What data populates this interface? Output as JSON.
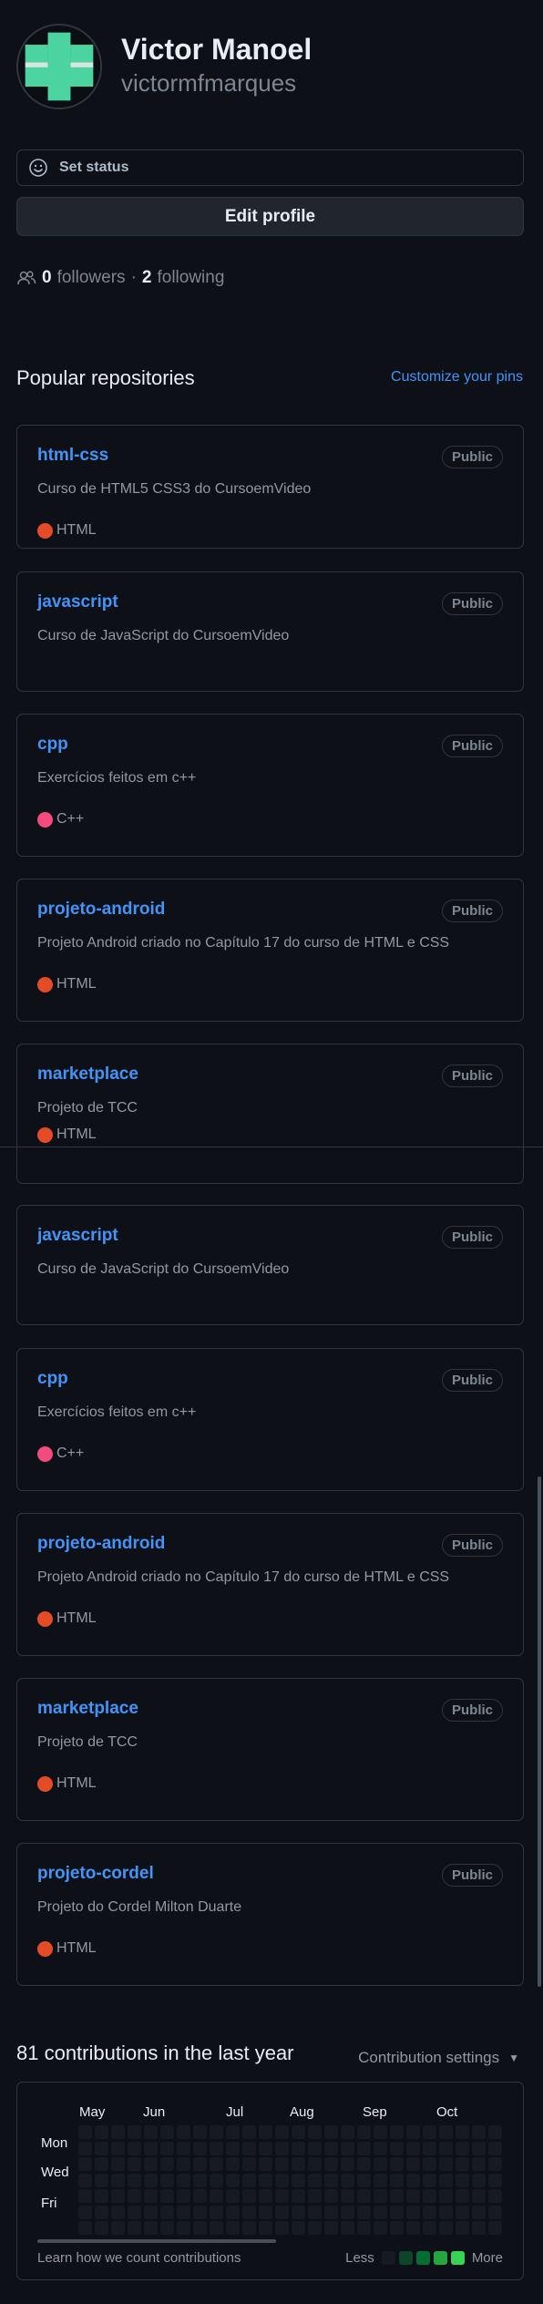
{
  "profile": {
    "name": "Victor Manoel",
    "login": "victormfmarques"
  },
  "status_button": {
    "label": "Set status"
  },
  "edit_button": {
    "label": "Edit profile"
  },
  "social": {
    "followers_count": "0",
    "followers_label": "followers",
    "separator": "·",
    "following_count": "2",
    "following_label": "following"
  },
  "popular": {
    "title": "Popular repositories",
    "customize_label": "Customize your pins"
  },
  "repos": [
    {
      "name": "html-css",
      "visibility": "Public",
      "description": "Curso de HTML5 CSS3 do CursoemVideo",
      "language": "HTML",
      "language_color": "#e34c26"
    },
    {
      "name": "javascript",
      "visibility": "Public",
      "description": "Curso de JavaScript do CursoemVideo",
      "language": "",
      "language_color": ""
    },
    {
      "name": "cpp",
      "visibility": "Public",
      "description": "Exercícios feitos em c++",
      "language": "C++",
      "language_color": "#f34b7d"
    },
    {
      "name": "projeto-android",
      "visibility": "Public",
      "description": "Projeto Android criado no Capítulo 17 do curso de HTML e CSS",
      "language": "HTML",
      "language_color": "#e34c26"
    },
    {
      "name": "marketplace",
      "visibility": "Public",
      "description": "Projeto de TCC",
      "language": "HTML",
      "language_color": "#e34c26"
    },
    {
      "name": "javascript",
      "visibility": "Public",
      "description": "Curso de JavaScript do CursoemVideo",
      "language": "",
      "language_color": ""
    },
    {
      "name": "cpp",
      "visibility": "Public",
      "description": "Exercícios feitos em c++",
      "language": "C++",
      "language_color": "#f34b7d"
    },
    {
      "name": "projeto-android",
      "visibility": "Public",
      "description": "Projeto Android criado no Capítulo 17 do curso de HTML e CSS",
      "language": "HTML",
      "language_color": "#e34c26"
    },
    {
      "name": "marketplace",
      "visibility": "Public",
      "description": "Projeto de TCC",
      "language": "HTML",
      "language_color": "#e34c26"
    },
    {
      "name": "projeto-cordel",
      "visibility": "Public",
      "description": "Projeto do Cordel Milton Duarte",
      "language": "HTML",
      "language_color": "#e34c26"
    }
  ],
  "contributions": {
    "title": "81 contributions in the last year",
    "settings_label": "Contribution settings",
    "months": [
      "May",
      "Jun",
      "Jul",
      "Aug",
      "Sep",
      "Oct"
    ],
    "days": [
      "Mon",
      "Wed",
      "Fri"
    ],
    "learn_label": "Learn how we count contributions",
    "legend_less": "Less",
    "legend_more": "More",
    "legend_colors": [
      "#161b22",
      "#0e4429",
      "#006d32",
      "#26a641",
      "#39d353"
    ]
  }
}
